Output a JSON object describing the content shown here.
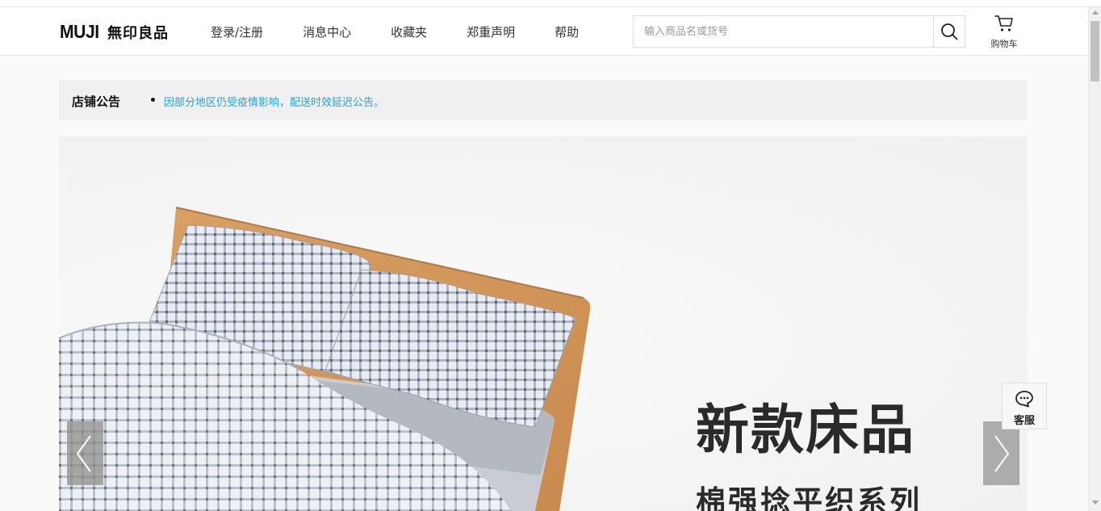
{
  "brand": {
    "logo_en": "MUJI",
    "logo_cn": "無印良品"
  },
  "nav": [
    {
      "label": "登录/注册"
    },
    {
      "label": "消息中心"
    },
    {
      "label": "收藏夹"
    },
    {
      "label": "郑重声明"
    },
    {
      "label": "帮助"
    }
  ],
  "search": {
    "placeholder": "输入商品名或货号",
    "value": "",
    "icon": "search-icon"
  },
  "cart": {
    "label": "购物车",
    "icon": "cart-icon"
  },
  "notice": {
    "title": "店铺公告",
    "text": "因部分地区仍受疫情影响，配送时效延迟公告。"
  },
  "banner": {
    "headline": "新款床品",
    "subline": "棉强捻平织系列"
  },
  "service": {
    "label": "客服",
    "icon": "chat-bubble-icon"
  },
  "colors": {
    "notice_link": "#27a0d8",
    "notice_bg": "#f0f0f0",
    "header_bg": "#ffffff"
  }
}
